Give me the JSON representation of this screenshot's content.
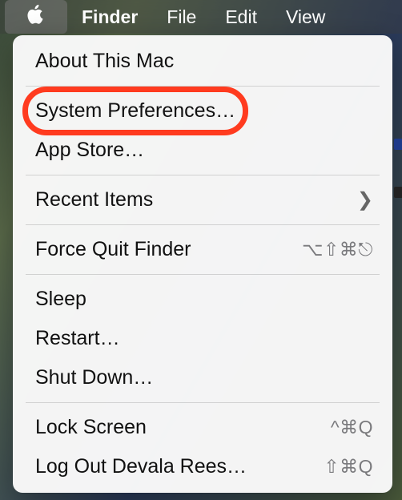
{
  "menubar": {
    "apple_icon": "apple-logo",
    "items": [
      "Finder",
      "File",
      "Edit",
      "View"
    ]
  },
  "apple_menu": {
    "about": "About This Mac",
    "system_prefs": "System Preferences…",
    "app_store": "App Store…",
    "recent_items": "Recent Items",
    "force_quit": "Force Quit Finder",
    "force_quit_shortcut": "⌥⇧⌘⎋",
    "sleep": "Sleep",
    "restart": "Restart…",
    "shut_down": "Shut Down…",
    "lock_screen": "Lock Screen",
    "lock_screen_shortcut": "^⌘Q",
    "log_out": "Log Out Devala Rees…",
    "log_out_shortcut": "⇧⌘Q"
  },
  "annotation": {
    "highlighted_item": "system_prefs"
  }
}
